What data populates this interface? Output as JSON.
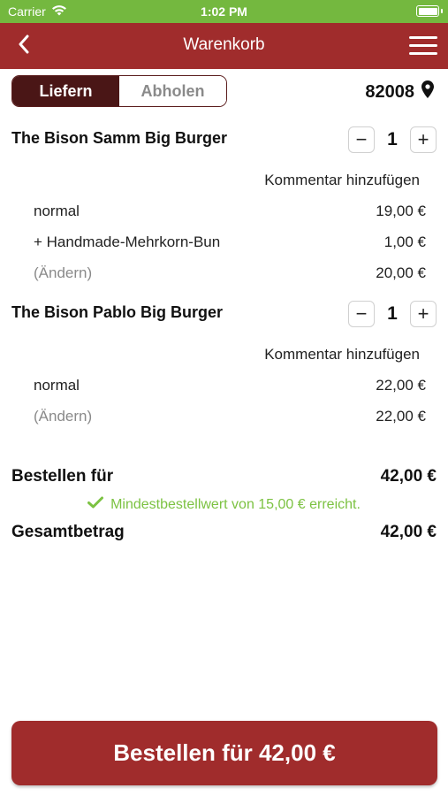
{
  "status_bar": {
    "carrier": "Carrier",
    "time": "1:02 PM"
  },
  "nav": {
    "title": "Warenkorb"
  },
  "delivery": {
    "options": [
      "Liefern",
      "Abholen"
    ],
    "selected": "Liefern",
    "zip": "82008"
  },
  "cart": {
    "items": [
      {
        "name": "The Bison Samm Big Burger",
        "quantity": "1",
        "comment_label": "Kommentar hinzufügen",
        "lines": [
          {
            "label": "normal",
            "price": "19,00 €"
          },
          {
            "label": "+ Handmade-Mehrkorn-Bun",
            "price": "1,00 €"
          }
        ],
        "change_label": "(Ändern)",
        "subtotal": "20,00 €"
      },
      {
        "name": "The Bison Pablo Big Burger",
        "quantity": "1",
        "comment_label": "Kommentar hinzufügen",
        "lines": [
          {
            "label": "normal",
            "price": "22,00 €"
          }
        ],
        "change_label": "(Ändern)",
        "subtotal": "22,00 €"
      }
    ]
  },
  "totals": {
    "order_for_label": "Bestellen für",
    "order_for_value": "42,00 €",
    "min_order_note": "Mindestbestellwert von 15,00 € erreicht.",
    "total_label": "Gesamtbetrag",
    "total_value": "42,00 €"
  },
  "order_button": {
    "label": "Bestellen für 42,00 €"
  },
  "colors": {
    "brand_red": "#a02c2c",
    "status_green": "#74b83f",
    "success_green": "#7cc242",
    "toggle_active": "#4a1616"
  },
  "icons": [
    "wifi-icon",
    "battery-icon",
    "back-chevron-icon",
    "hamburger-menu-icon",
    "location-pin-icon",
    "minus-icon",
    "plus-icon",
    "checkmark-icon"
  ]
}
